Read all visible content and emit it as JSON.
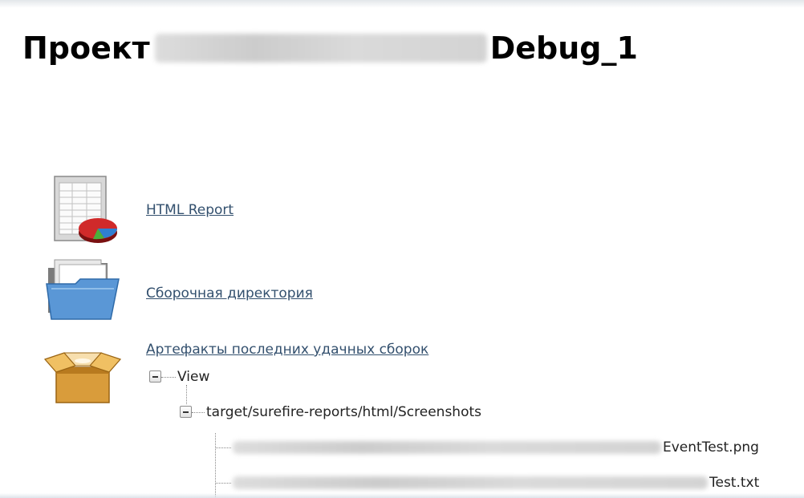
{
  "header": {
    "title_prefix": "Проект",
    "title_suffix": "Debug_1"
  },
  "links": {
    "html_report": "HTML Report",
    "build_directory": "Сборочная директория",
    "last_successful_artifacts": "Артефакты последних удачных сборок"
  },
  "tree": {
    "root_label": "View",
    "folder_label": "target/surefire-reports/html/Screenshots",
    "files": [
      "EventTest.png",
      "Test.txt"
    ]
  },
  "icons": {
    "report": "spreadsheet-pie-chart-icon",
    "folder": "open-folder-icon",
    "package": "open-box-icon"
  },
  "colors": {
    "link": "#33506e"
  }
}
